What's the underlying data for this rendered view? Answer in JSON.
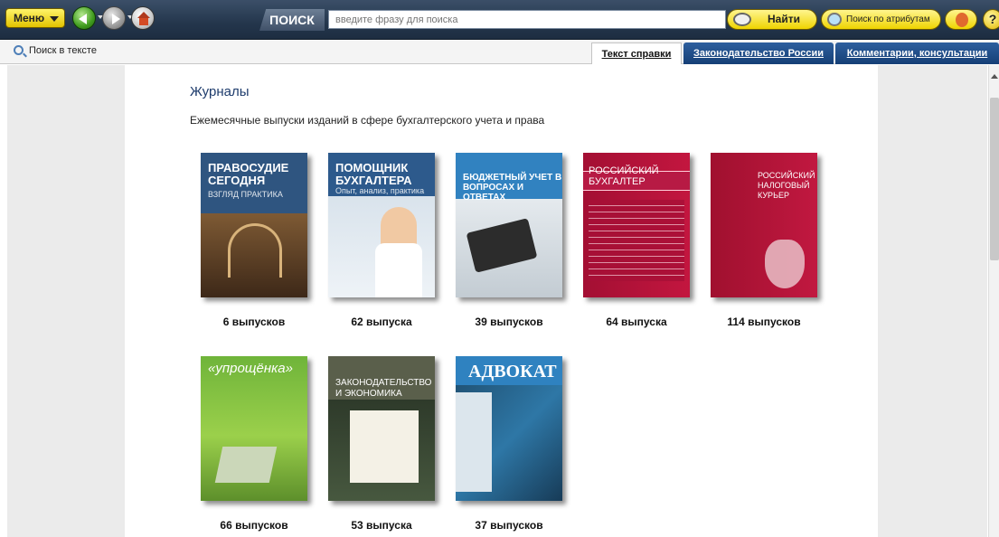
{
  "toolbar": {
    "menu_label": "Меню",
    "search_label": "ПОИСК",
    "search_placeholder": "введите фразу для поиска",
    "find_label": "Найти",
    "attr_search_label": "Поиск по атрибутам",
    "help_label": "?"
  },
  "subbar": {
    "text_search": "Поиск в тексте",
    "tabs": [
      {
        "label": "Текст справки",
        "active": true
      },
      {
        "label": "Законодательство России",
        "active": false
      },
      {
        "label": "Комментарии, консультации",
        "active": false
      }
    ]
  },
  "content": {
    "title": "Журналы",
    "subtitle": "Ежемесячные выпуски изданий в сфере бухгалтерского учета и права",
    "magazines": [
      {
        "cover_title": "ПРАВОСУДИЕ СЕГОДНЯ",
        "cover_sub": "ВЗГЛЯД ПРАКТИКА",
        "issues": "6 выпусков"
      },
      {
        "cover_title": "ПОМОЩНИК БУХГАЛТЕРА",
        "cover_sub": "Опыт, анализ, практика",
        "issues": "62 выпуска"
      },
      {
        "cover_title": "БЮДЖЕТНЫЙ УЧЕТ В ВОПРОСАХ И ОТВЕТАХ",
        "cover_sub": "",
        "issues": "39 выпусков"
      },
      {
        "cover_title": "РОССИЙСКИЙ БУХГАЛТЕР",
        "cover_sub": "",
        "issues": "64 выпуска"
      },
      {
        "cover_title": "РОССИЙСКИЙ НАЛОГОВЫЙ КУРЬЕР",
        "cover_sub": "",
        "issues": "114 выпусков"
      },
      {
        "cover_title": "«упрощёнка»",
        "cover_sub": "",
        "issues": "66 выпусков"
      },
      {
        "cover_title": "ЗАКОНОДАТЕЛЬСТВО И ЭКОНОМИКА",
        "cover_sub": "",
        "issues": "53 выпуска"
      },
      {
        "cover_title": "АДВОКАТ",
        "cover_sub": "",
        "issues": "37 выпусков"
      }
    ]
  }
}
